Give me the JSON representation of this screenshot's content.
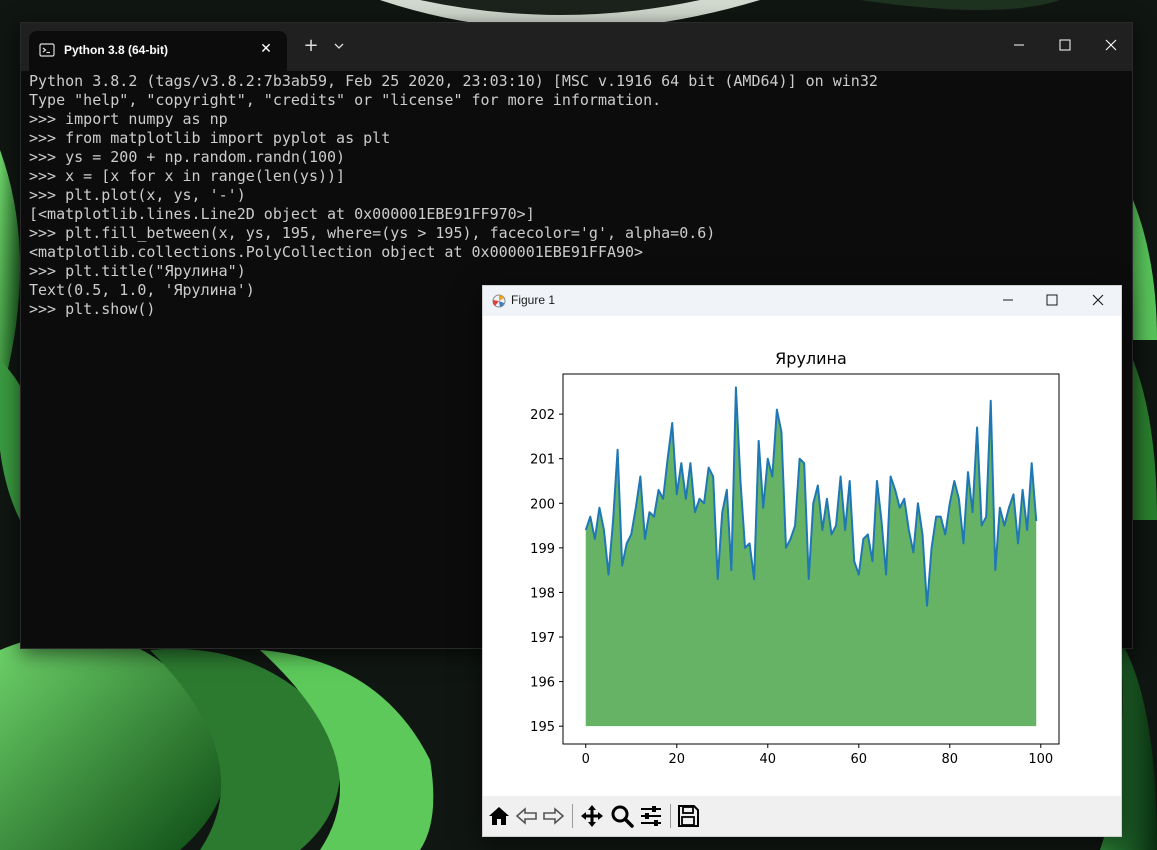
{
  "terminal": {
    "tab_title": "Python 3.8 (64-bit)",
    "lines": [
      "Python 3.8.2 (tags/v3.8.2:7b3ab59, Feb 25 2020, 23:03:10) [MSC v.1916 64 bit (AMD64)] on win32",
      "Type \"help\", \"copyright\", \"credits\" or \"license\" for more information.",
      ">>> import numpy as np",
      ">>> from matplotlib import pyplot as plt",
      ">>> ys = 200 + np.random.randn(100)",
      ">>> x = [x for x in range(len(ys))]",
      ">>> plt.plot(x, ys, '-')",
      "[<matplotlib.lines.Line2D object at 0x000001EBE91FF970>]",
      ">>> plt.fill_between(x, ys, 195, where=(ys > 195), facecolor='g', alpha=0.6)",
      "<matplotlib.collections.PolyCollection object at 0x000001EBE91FFA90>",
      ">>> plt.title(\"Ярулина\")",
      "Text(0.5, 1.0, 'Ярулина')",
      ">>> plt.show()"
    ]
  },
  "figure": {
    "window_title": "Figure 1",
    "toolbar_icons": [
      "home-icon",
      "back-arrow-icon",
      "forward-arrow-icon",
      "pan-icon",
      "zoom-icon",
      "configure-subplots-icon",
      "save-icon"
    ]
  },
  "chart_data": {
    "type": "area",
    "title": "Ярулина",
    "xlabel": "",
    "ylabel": "",
    "xlim": [
      -5,
      104
    ],
    "ylim": [
      194.6,
      202.9
    ],
    "xticks": [
      0,
      20,
      40,
      60,
      80,
      100
    ],
    "yticks": [
      195,
      196,
      197,
      198,
      199,
      200,
      201,
      202
    ],
    "fill_baseline": 195,
    "line_color": "#1f77b4",
    "fill_color": "#008000",
    "fill_alpha": 0.6,
    "x": [
      0,
      1,
      2,
      3,
      4,
      5,
      6,
      7,
      8,
      9,
      10,
      11,
      12,
      13,
      14,
      15,
      16,
      17,
      18,
      19,
      20,
      21,
      22,
      23,
      24,
      25,
      26,
      27,
      28,
      29,
      30,
      31,
      32,
      33,
      34,
      35,
      36,
      37,
      38,
      39,
      40,
      41,
      42,
      43,
      44,
      45,
      46,
      47,
      48,
      49,
      50,
      51,
      52,
      53,
      54,
      55,
      56,
      57,
      58,
      59,
      60,
      61,
      62,
      63,
      64,
      65,
      66,
      67,
      68,
      69,
      70,
      71,
      72,
      73,
      74,
      75,
      76,
      77,
      78,
      79,
      80,
      81,
      82,
      83,
      84,
      85,
      86,
      87,
      88,
      89,
      90,
      91,
      92,
      93,
      94,
      95,
      96,
      97,
      98,
      99
    ],
    "y": [
      199.4,
      199.7,
      199.2,
      199.9,
      199.4,
      198.4,
      199.6,
      201.2,
      198.6,
      199.1,
      199.3,
      199.9,
      200.6,
      199.2,
      199.8,
      199.7,
      200.3,
      200.1,
      201.0,
      201.8,
      200.2,
      200.9,
      200.1,
      200.9,
      199.8,
      200.1,
      200.0,
      200.8,
      200.6,
      198.3,
      199.8,
      200.3,
      198.5,
      202.6,
      200.5,
      199.0,
      199.1,
      198.3,
      201.4,
      199.9,
      201.0,
      200.6,
      202.1,
      201.6,
      199.0,
      199.2,
      199.5,
      201.0,
      200.9,
      198.3,
      200.0,
      200.4,
      199.4,
      200.1,
      199.3,
      199.5,
      200.6,
      199.4,
      200.5,
      198.7,
      198.4,
      199.2,
      199.3,
      198.7,
      200.5,
      199.6,
      198.4,
      200.6,
      200.3,
      199.9,
      200.1,
      199.4,
      198.9,
      200.0,
      199.3,
      197.7,
      199.0,
      199.7,
      199.7,
      199.3,
      200.0,
      200.5,
      200.1,
      199.1,
      200.7,
      199.8,
      201.7,
      199.5,
      199.7,
      202.3,
      198.5,
      199.9,
      199.5,
      199.9,
      200.2,
      199.1,
      200.3,
      199.4,
      200.9,
      199.6
    ]
  }
}
